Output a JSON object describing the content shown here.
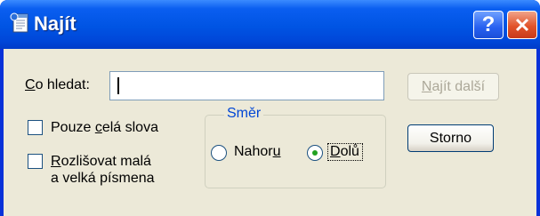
{
  "window": {
    "title": "Najít",
    "help_button": "?",
    "close_button_icon": "close-icon"
  },
  "search": {
    "label_prefix": "",
    "label_mnemonic": "C",
    "label_rest": "o hledat:",
    "value": ""
  },
  "buttons": {
    "find_next_mnemonic": "N",
    "find_next_rest": "ajít další",
    "find_next_enabled": false,
    "cancel_label": "Storno"
  },
  "options": {
    "whole_words": {
      "label_prefix": "Pouze ",
      "label_mnemonic": "c",
      "label_rest": "elá slova",
      "checked": false
    },
    "match_case": {
      "label_mnemonic": "R",
      "label_rest": "ozlišovat malá",
      "label_line2": "a velká písmena",
      "checked": false
    }
  },
  "direction": {
    "legend": "Směr",
    "up": {
      "label_prefix": "Nahor",
      "label_mnemonic": "u",
      "label_rest": "",
      "selected": false
    },
    "down": {
      "label_prefix": "",
      "label_mnemonic": "D",
      "label_rest": "olů",
      "selected": true
    }
  },
  "colors": {
    "titlebar": "#0054e3",
    "dialog_background": "#ece9d8",
    "group_legend": "#0046d5",
    "close_button": "#e2542a",
    "radio_selected": "#21a121"
  }
}
